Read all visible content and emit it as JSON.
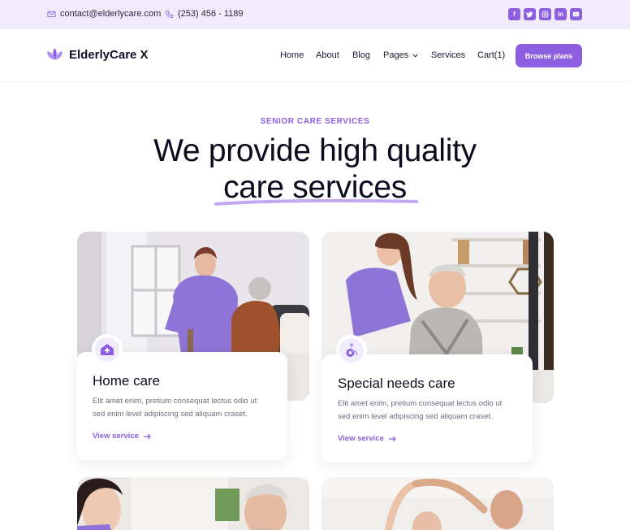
{
  "topbar": {
    "email": "contact@elderlycare.com",
    "phone": "(253) 456 - 1189",
    "socials": [
      "f",
      "t",
      "ig",
      "in",
      "yt"
    ]
  },
  "header": {
    "brand": "ElderlyCare X",
    "nav": [
      "Home",
      "About",
      "Blog",
      "Pages",
      "Services",
      "Cart(1)"
    ],
    "cta": "Browse plans"
  },
  "hero": {
    "eyebrow": "SENIOR CARE SERVICES",
    "headline_line1": "We provide high quality",
    "headline_line2": "care services"
  },
  "cards": [
    {
      "icon": "home-care-icon",
      "title": "Home care",
      "description_line1": "Elit amet enim, pretium consequat lectus odio ut",
      "description_line2": "sed enim level adipiscing sed aliquam craset.",
      "link": "View service"
    },
    {
      "icon": "wheelchair-icon",
      "title": "Special needs care",
      "description_line1": "Elit amet enim, pretium consequat lectus odio ut",
      "description_line2": "sed enim level adipiscing sed aliquam craset.",
      "link": "View service"
    }
  ],
  "colors": {
    "accent": "#8d5fe0",
    "topbar_bg": "#f1ecfc",
    "heading": "#0e0b1f",
    "body_text": "#6f6a7e"
  }
}
